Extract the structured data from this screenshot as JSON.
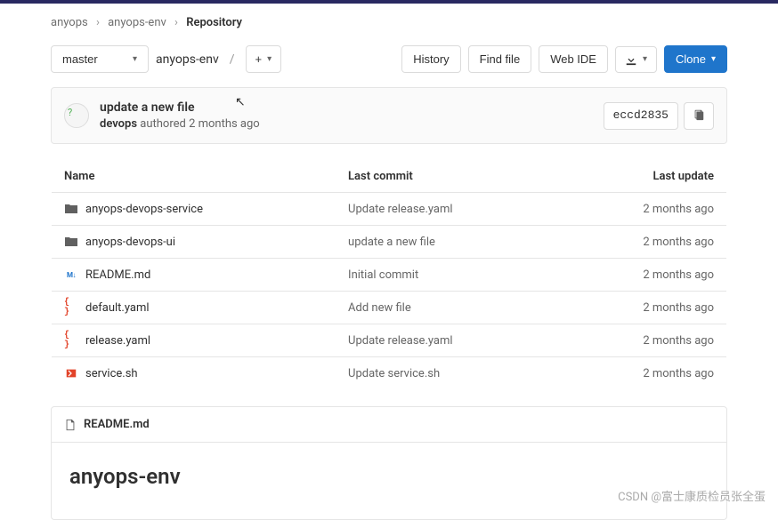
{
  "breadcrumb": {
    "root": "anyops",
    "group": "anyops-env",
    "current": "Repository"
  },
  "toolbar": {
    "branch": "master",
    "path_part": "anyops-env",
    "history": "History",
    "find_file": "Find file",
    "web_ide": "Web IDE",
    "clone": "Clone"
  },
  "commit": {
    "title": "update a new file",
    "author": "devops",
    "verb": "authored",
    "time": "2 months ago",
    "sha": "eccd2835"
  },
  "headers": {
    "name": "Name",
    "last_commit": "Last commit",
    "last_update": "Last update"
  },
  "files": [
    {
      "icon": "folder",
      "name": "anyops-devops-service",
      "commit": "Update release.yaml",
      "update": "2 months ago"
    },
    {
      "icon": "folder",
      "name": "anyops-devops-ui",
      "commit": "update a new file",
      "update": "2 months ago"
    },
    {
      "icon": "md",
      "name": "README.md",
      "commit": "Initial commit",
      "update": "2 months ago"
    },
    {
      "icon": "yaml",
      "name": "default.yaml",
      "commit": "Add new file",
      "update": "2 months ago"
    },
    {
      "icon": "yaml",
      "name": "release.yaml",
      "commit": "Update release.yaml",
      "update": "2 months ago"
    },
    {
      "icon": "sh",
      "name": "service.sh",
      "commit": "Update service.sh",
      "update": "2 months ago"
    }
  ],
  "readme": {
    "filename": "README.md",
    "heading": "anyops-env"
  },
  "watermark": "CSDN @富士康质检员张全蛋"
}
